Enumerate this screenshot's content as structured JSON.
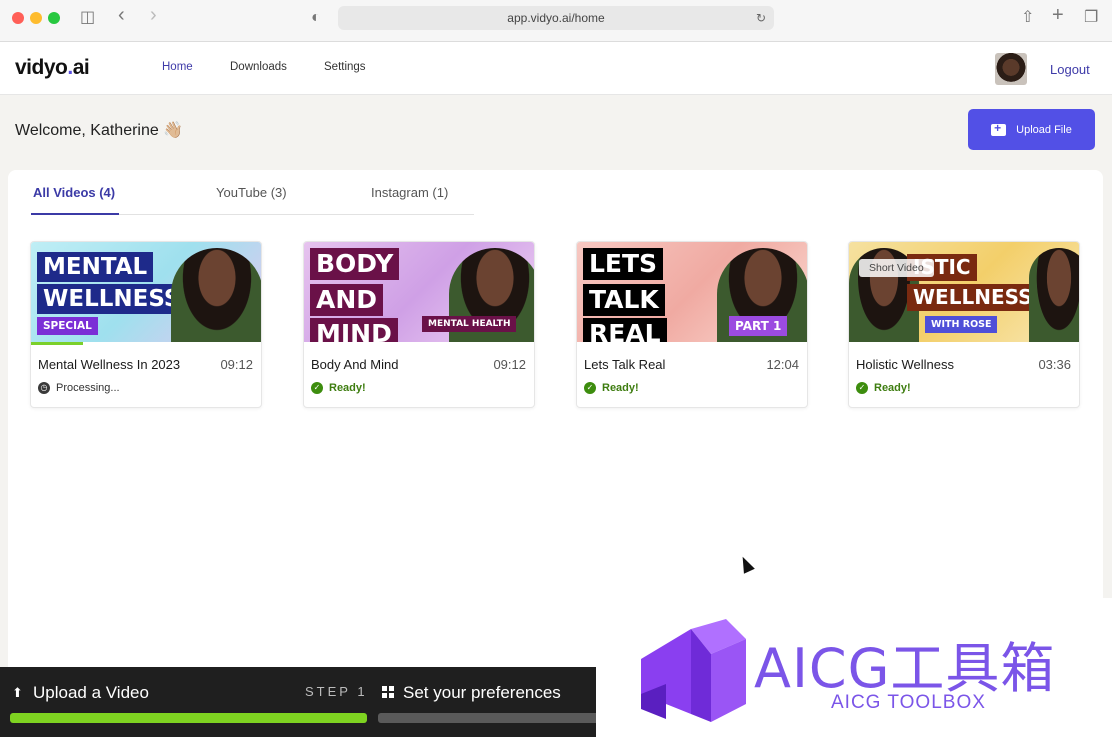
{
  "browser": {
    "url": "app.vidyo.ai/home"
  },
  "nav": {
    "logo_text": "vidyo",
    "logo_dot": ".",
    "logo_suffix": "ai",
    "links": [
      "Home",
      "Downloads",
      "Settings"
    ],
    "logout": "Logout"
  },
  "welcome": {
    "text": "Welcome, Katherine 👋🏼",
    "upload_label": "Upload File"
  },
  "tabs": [
    {
      "label": "All Videos (4)",
      "active": true
    },
    {
      "label": "YouTube (3)",
      "active": false
    },
    {
      "label": "Instagram (1)",
      "active": false
    }
  ],
  "videos": [
    {
      "title": "Mental Wellness In 2023",
      "duration": "09:12",
      "status": "Processing...",
      "thumb_lines": [
        "MENTAL",
        "WELLNESS"
      ],
      "thumb_tag": "SPECIAL",
      "accent": "#1e2a8a"
    },
    {
      "title": "Body And Mind",
      "duration": "09:12",
      "status": "Ready!",
      "thumb_lines": [
        "BODY",
        "AND",
        "MIND"
      ],
      "thumb_tag": "MENTAL HEALTH",
      "accent": "#6a1148"
    },
    {
      "title": "Lets Talk Real",
      "duration": "12:04",
      "status": "Ready!",
      "thumb_lines": [
        "LETS",
        "TALK",
        "REAL"
      ],
      "thumb_tag": "PART 1",
      "accent": "#000000"
    },
    {
      "title": "Holistic Wellness",
      "duration": "03:36",
      "status": "Ready!",
      "thumb_lines": [
        "ISTIC",
        "WELLNESS"
      ],
      "thumb_tag": "WITH ROSE",
      "badge": "Short Video",
      "accent": "#7a2a10"
    }
  ],
  "steps": {
    "step1_label": "Upload a Video",
    "step1_num": "STEP 1",
    "step2_label": "Set your preferences"
  },
  "watermark": {
    "title": "AICG工具箱",
    "subtitle": "AICG TOOLBOX"
  }
}
